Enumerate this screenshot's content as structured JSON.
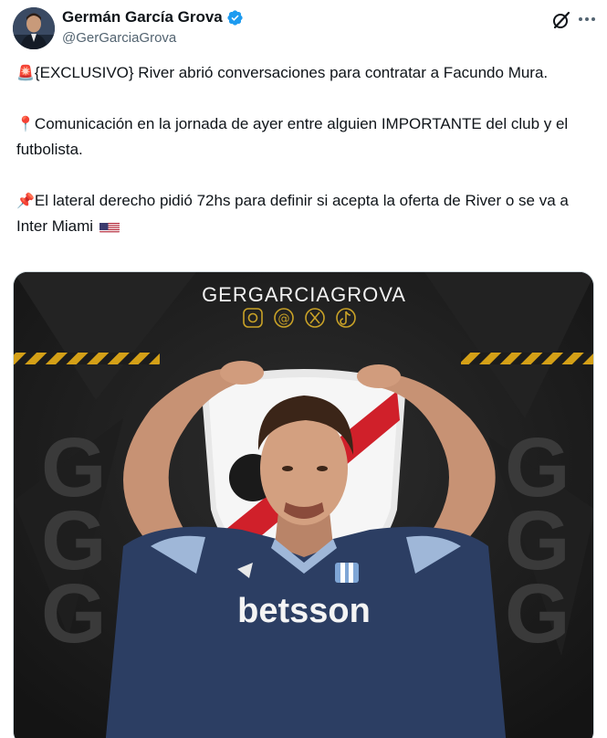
{
  "author": {
    "display_name": "Germán García Grova",
    "handle": "@GerGarciaGrova",
    "verified": true
  },
  "header": {
    "grok_icon": "grok-icon",
    "more_icon": "more-icon"
  },
  "tweet": {
    "paragraphs": [
      {
        "emoji": "🚨",
        "emoji_icon": "siren-icon",
        "text": "{EXCLUSIVO} River abrió conversaciones para contratar a Facundo Mura."
      },
      {
        "emoji": "📍",
        "emoji_icon": "round-pushpin-icon",
        "text": "Comunicación en la jornada de ayer entre alguien IMPORTANTE del club y el futbolista."
      },
      {
        "emoji": "📌",
        "emoji_icon": "pushpin-icon",
        "text": "El lateral derecho pidió 72hs para definir si acepta la oferta de River o se va a Inter Miami",
        "trailing_icon": "us-flag-icon"
      }
    ]
  },
  "media": {
    "watermark_title": "GERGARCIAGROVA",
    "social_icons": [
      "instagram-icon",
      "threads-icon",
      "x-icon",
      "tiktok-icon"
    ],
    "background_letter": "G",
    "shirt_sponsor": "betsson",
    "colors": {
      "background": "#1c1c1c",
      "hazard_stripe": "#d4a017",
      "river_red": "#d0202a",
      "shirt_blue": "#2c3e63",
      "accent_gold": "#c9a227"
    }
  },
  "colors": {
    "verified_blue": "#1d9bf0",
    "secondary_text": "#536471",
    "primary_text": "#0f1419"
  }
}
